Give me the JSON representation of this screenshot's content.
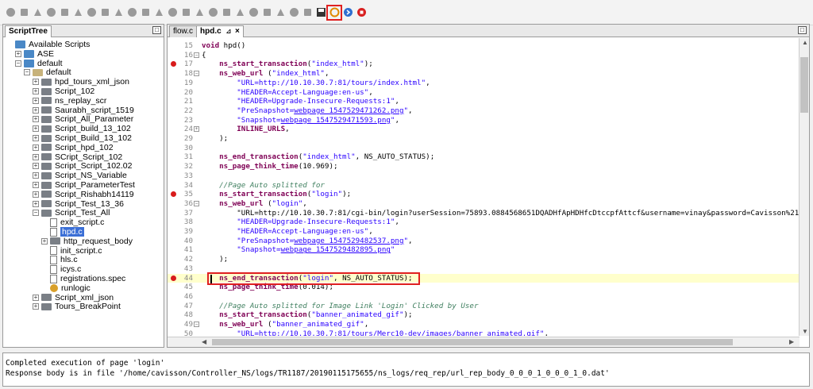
{
  "toolbar": {
    "icons": [
      "record-icon",
      "stop-icon",
      "play-icon",
      "pause-icon",
      "list-icon",
      "comment-icon",
      "note-icon",
      "doc-icon",
      "save-icon",
      "down-icon",
      "up-icon",
      "tag-icon",
      "puzzle-icon",
      "gear-icon",
      "image-icon",
      "grid-icon",
      "dot-icon",
      "doc2-icon",
      "box-icon",
      "circle-icon",
      "pdf-icon",
      "upload-icon",
      "monitor-icon",
      "floppy-icon",
      "refresh-icon",
      "next-icon",
      "stop-red-icon"
    ]
  },
  "left_panel": {
    "tab": "ScriptTree",
    "tree": [
      {
        "label": "Available Scripts",
        "indent": 0,
        "type": "root"
      },
      {
        "label": "ASE",
        "indent": 1,
        "type": "project",
        "exp": "+"
      },
      {
        "label": "default",
        "indent": 1,
        "type": "project",
        "exp": "-"
      },
      {
        "label": "default",
        "indent": 2,
        "type": "sub",
        "exp": "-"
      },
      {
        "label": "hpd_tours_xml_json",
        "indent": 3,
        "type": "folder",
        "exp": "+"
      },
      {
        "label": "Script_102",
        "indent": 3,
        "type": "folder",
        "exp": "+"
      },
      {
        "label": "ns_replay_scr",
        "indent": 3,
        "type": "folder",
        "exp": "+"
      },
      {
        "label": "Saurabh_script_1519",
        "indent": 3,
        "type": "folder",
        "exp": "+"
      },
      {
        "label": "Script_All_Parameter",
        "indent": 3,
        "type": "folder",
        "exp": "+"
      },
      {
        "label": "Script_build_13_102",
        "indent": 3,
        "type": "folder",
        "exp": "+"
      },
      {
        "label": "Script_Build_13_102",
        "indent": 3,
        "type": "folder",
        "exp": "+"
      },
      {
        "label": "Script_hpd_102",
        "indent": 3,
        "type": "folder",
        "exp": "+"
      },
      {
        "label": "SCript_Script_102",
        "indent": 3,
        "type": "folder",
        "exp": "+"
      },
      {
        "label": "Script_Script_102.02",
        "indent": 3,
        "type": "folder",
        "exp": "+"
      },
      {
        "label": "Script_NS_Variable",
        "indent": 3,
        "type": "folder",
        "exp": "+"
      },
      {
        "label": "Script_ParameterTest",
        "indent": 3,
        "type": "folder",
        "exp": "+"
      },
      {
        "label": "Script_Rishabh14119",
        "indent": 3,
        "type": "folder",
        "exp": "+"
      },
      {
        "label": "Script_Test_13_36",
        "indent": 3,
        "type": "folder",
        "exp": "+"
      },
      {
        "label": "Script_Test_All",
        "indent": 3,
        "type": "folder",
        "exp": "-"
      },
      {
        "label": "exit_script.c",
        "indent": 4,
        "type": "file"
      },
      {
        "label": "hpd.c",
        "indent": 4,
        "type": "file",
        "selected": true
      },
      {
        "label": "http_request_body",
        "indent": 4,
        "type": "folder",
        "exp": "+"
      },
      {
        "label": "init_script.c",
        "indent": 4,
        "type": "file"
      },
      {
        "label": "hls.c",
        "indent": 4,
        "type": "file"
      },
      {
        "label": "icys.c",
        "indent": 4,
        "type": "file"
      },
      {
        "label": "registrations.spec",
        "indent": 4,
        "type": "file"
      },
      {
        "label": "runlogic",
        "indent": 4,
        "type": "gear"
      },
      {
        "label": "Script_xml_json",
        "indent": 3,
        "type": "folder",
        "exp": "+"
      },
      {
        "label": "Tours_BreakPoint",
        "indent": 3,
        "type": "folder",
        "exp": "+"
      }
    ]
  },
  "editor": {
    "tabs": [
      {
        "label": "flow.c"
      },
      {
        "label": "hpd.c"
      }
    ],
    "active_tab_close": "×",
    "lines": [
      {
        "n": "15",
        "t": "void hpd()"
      },
      {
        "n": "16",
        "t": "{",
        "fold": "-"
      },
      {
        "n": "17",
        "t": "    ns_start_transaction(\"index_html\");",
        "bp": true
      },
      {
        "n": "18",
        "t": "    ns_web_url (\"index_html\",",
        "fold": "-"
      },
      {
        "n": "19",
        "t": "        \"URL=http://10.10.30.7:81/tours/index.html\","
      },
      {
        "n": "20",
        "t": "        \"HEADER=Accept-Language:en-us\","
      },
      {
        "n": "21",
        "t": "        \"HEADER=Upgrade-Insecure-Requests:1\","
      },
      {
        "n": "22",
        "t": "        \"PreSnapshot=webpage_1547529471262.png\","
      },
      {
        "n": "23",
        "t": "        \"Snapshot=webpage_1547529471593.png\","
      },
      {
        "n": "24",
        "t": "        INLINE_URLS,",
        "fold": "+"
      },
      {
        "n": "29",
        "t": "    );"
      },
      {
        "n": "30",
        "t": ""
      },
      {
        "n": "31",
        "t": "    ns_end_transaction(\"index_html\", NS_AUTO_STATUS);"
      },
      {
        "n": "32",
        "t": "    ns_page_think_time(10.969);"
      },
      {
        "n": "33",
        "t": ""
      },
      {
        "n": "34",
        "t": "    //Page Auto splitted for"
      },
      {
        "n": "35",
        "t": "    ns_start_transaction(\"login\");",
        "bp": true
      },
      {
        "n": "36",
        "t": "    ns_web_url (\"login\",",
        "fold": "-"
      },
      {
        "n": "37",
        "t": "        \"URL=http://10.10.30.7:81/cgi-bin/login?userSession=75893.0884568651DQADHfApHDHfcDtccpfAttcf&username=vinay&password=Cavisson%21&login.x"
      },
      {
        "n": "38",
        "t": "        \"HEADER=Upgrade-Insecure-Requests:1\","
      },
      {
        "n": "39",
        "t": "        \"HEADER=Accept-Language:en-us\","
      },
      {
        "n": "40",
        "t": "        \"PreSnapshot=webpage_1547529482537.png\","
      },
      {
        "n": "41",
        "t": "        \"Snapshot=webpage_1547529482895.png\""
      },
      {
        "n": "42",
        "t": "    );"
      },
      {
        "n": "43",
        "t": ""
      },
      {
        "n": "44",
        "t": "    ns_end_transaction(\"login\", NS_AUTO_STATUS);",
        "bp": true,
        "hl": true
      },
      {
        "n": "45",
        "t": "    ns_page_think_time(0.014);"
      },
      {
        "n": "46",
        "t": ""
      },
      {
        "n": "47",
        "t": "    //Page Auto splitted for Image Link 'Login' Clicked by User"
      },
      {
        "n": "48",
        "t": "    ns_start_transaction(\"banner_animated_gif\");"
      },
      {
        "n": "49",
        "t": "    ns_web_url (\"banner_animated_gif\",",
        "fold": "-"
      },
      {
        "n": "50",
        "t": "        \"URL=http://10.10.30.7:81/tours/Merc10-dev/images/banner_animated.gif\","
      }
    ]
  },
  "console": {
    "lines": [
      "Completed execution of page 'login'",
      "Response body is in file '/home/cavisson/Controller_NS/logs/TR1187/20190115175655/ns_logs/req_rep/url_rep_body_0_0_0_1_0_0_0_1_0.dat'"
    ]
  }
}
